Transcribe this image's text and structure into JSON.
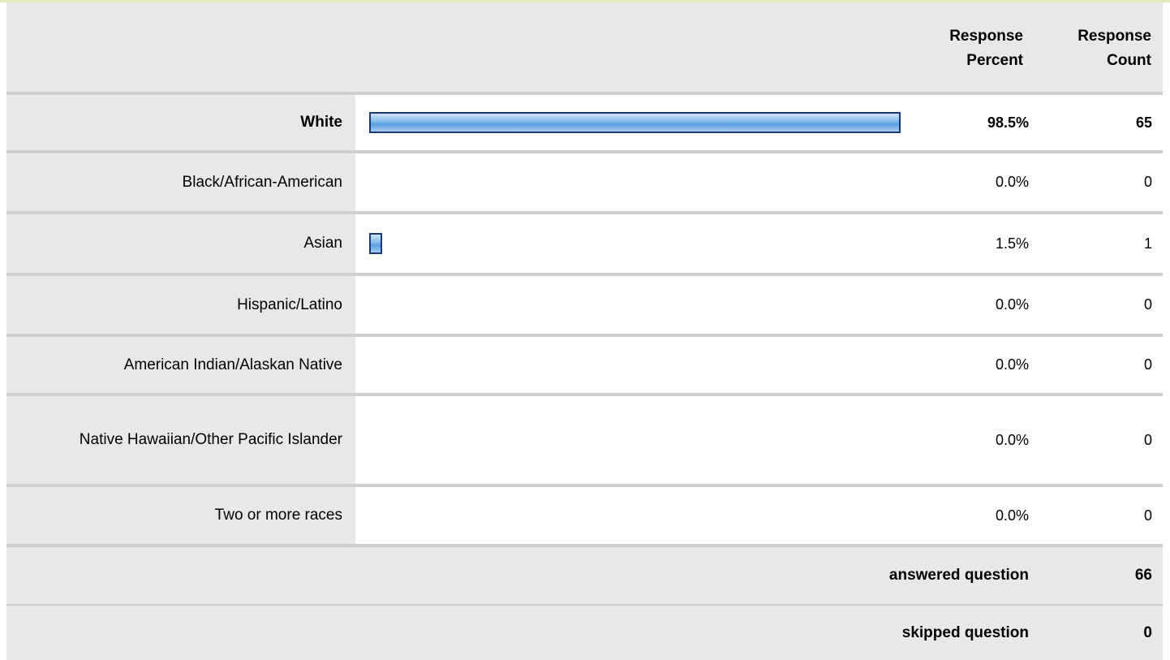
{
  "header": {
    "response_percent": [
      "Response",
      "Percent"
    ],
    "response_count": [
      "Response",
      "Count"
    ]
  },
  "colors": {
    "bar_fill": "#8bbfee",
    "bar_border": "#1b3a73",
    "label_bg": "#e8e8e8"
  },
  "rows": [
    {
      "label": "White",
      "percent": "98.5%",
      "count": "65",
      "share": 0.985
    },
    {
      "label": "Black/African-American",
      "percent": "0.0%",
      "count": "0",
      "share": 0
    },
    {
      "label": "Asian",
      "percent": "1.5%",
      "count": "1",
      "share": 0.015
    },
    {
      "label": "Hispanic/Latino",
      "percent": "0.0%",
      "count": "0",
      "share": 0
    },
    {
      "label": "American Indian/Alaskan Native",
      "percent": "0.0%",
      "count": "0",
      "share": 0
    },
    {
      "label": "Native Hawaiian/Other Pacific Islander",
      "percent": "0.0%",
      "count": "0",
      "share": 0
    },
    {
      "label": "Two or more races",
      "percent": "0.0%",
      "count": "0",
      "share": 0
    }
  ],
  "footer": {
    "answered_label": "answered question",
    "answered_value": "66",
    "skipped_label": "skipped question",
    "skipped_value": "0"
  }
}
